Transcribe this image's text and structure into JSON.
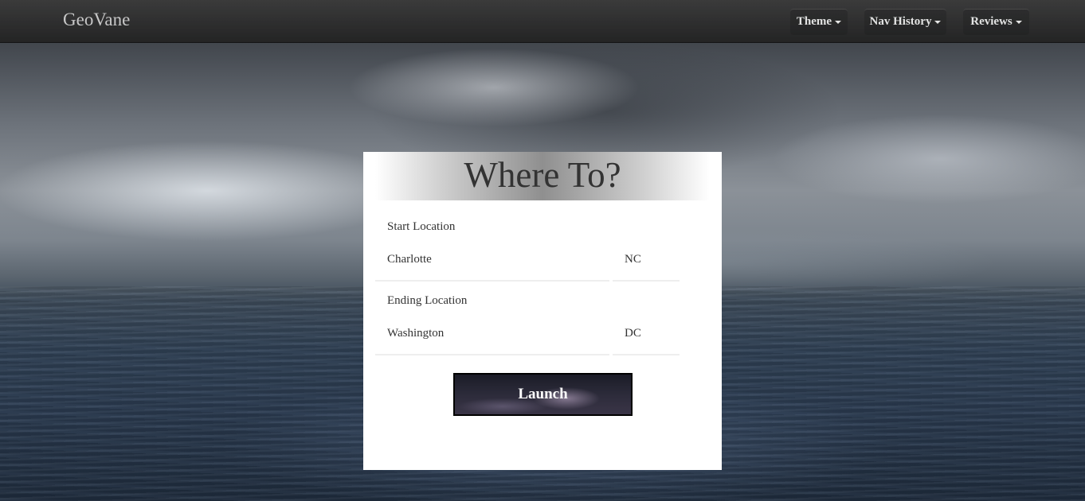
{
  "app": {
    "brand": "GeoVane"
  },
  "nav": {
    "items": [
      {
        "label": "Theme"
      },
      {
        "label": "Nav History"
      },
      {
        "label": "Reviews"
      }
    ]
  },
  "form": {
    "title": "Where To?",
    "start_label": "Start Location",
    "start_city": "Charlotte",
    "start_state": "NC",
    "end_label": "Ending Location",
    "end_city": "Washington",
    "end_state": "DC",
    "launch_label": "Launch"
  },
  "icons": {
    "dropdown": "chevron-down-icon"
  }
}
